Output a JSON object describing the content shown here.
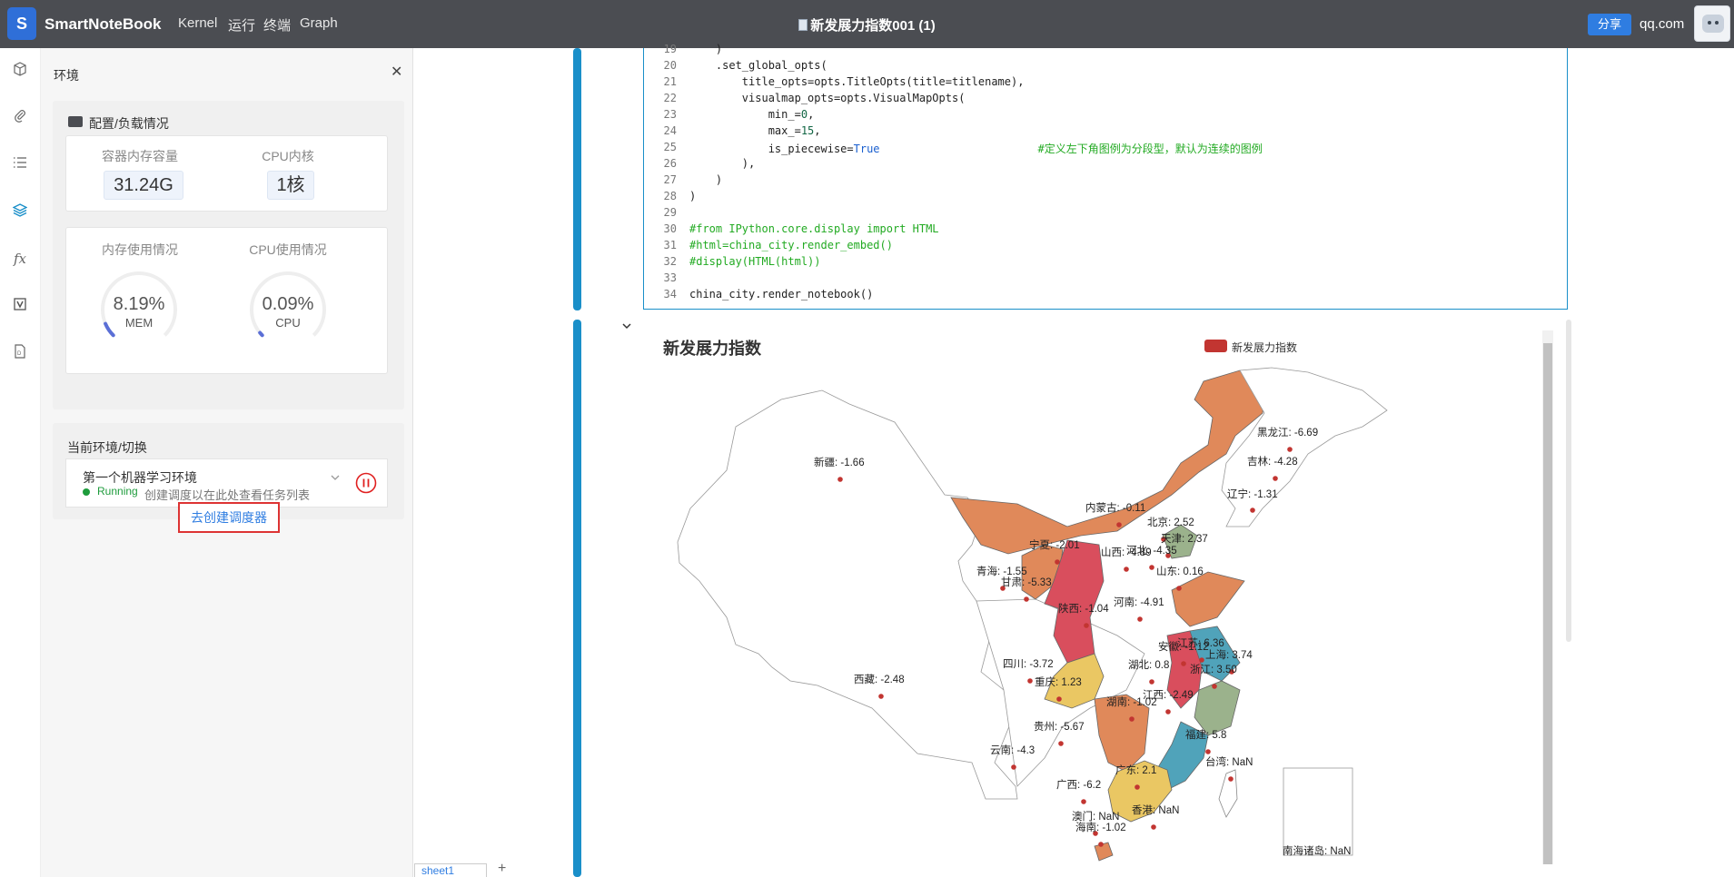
{
  "topbar": {
    "logo_text": "S",
    "brand": "SmartNoteBook",
    "menu": [
      "Kernel",
      "运行",
      "终端",
      "Graph"
    ],
    "doc_icon": "notebook-icon",
    "doc_title": "新发展力指数001 (1)",
    "share_label": "分享",
    "user": "qq.com"
  },
  "rail": {
    "icons": [
      "cube-icon",
      "paperclip-icon",
      "list-icon",
      "layers-icon",
      "fx-icon",
      "variable-icon",
      "file-icon"
    ],
    "fx_label": "fx"
  },
  "env_panel": {
    "title": "环境",
    "config": {
      "heading": "配置/负载情况",
      "mem_capacity_label": "容器内存容量",
      "mem_capacity_value": "31.24G",
      "cpu_cores_label": "CPU内核",
      "cpu_cores_value": "1核",
      "mem_usage_label": "内存使用情况",
      "mem_usage_value": "8.19%",
      "mem_usage_fraction": 0.0819,
      "mem_unit": "MEM",
      "cpu_usage_label": "CPU使用情况",
      "cpu_usage_value": "0.09%",
      "cpu_usage_fraction": 0.0009,
      "cpu_unit": "CPU"
    },
    "current_env": {
      "heading": "当前环境/切换",
      "env_name": "第一个机器学习环境",
      "status": "Running",
      "status_color": "#1e9c3c"
    },
    "schedule_text": "创建调度以在此处查看任务列表",
    "schedule_button": "去创建调度器"
  },
  "code": {
    "lines": [
      {
        "n": "19",
        "text": "    )"
      },
      {
        "n": "20",
        "text": "    .set_global_opts("
      },
      {
        "n": "21",
        "text": "        title_opts=opts.TitleOpts(title=titlename),"
      },
      {
        "n": "22",
        "text": "        visualmap_opts=opts.VisualMapOpts("
      },
      {
        "n": "23",
        "text": "            min_=",
        "num": "0",
        "tail": ","
      },
      {
        "n": "24",
        "text": "            max_=",
        "num": "15",
        "tail": ","
      },
      {
        "n": "25",
        "text": "            is_piecewise=",
        "bool": "True",
        "comment": "#定义左下角图例为分段型，默认为连续的图例"
      },
      {
        "n": "26",
        "text": "        ),"
      },
      {
        "n": "27",
        "text": "    )"
      },
      {
        "n": "28",
        "text": ")"
      },
      {
        "n": "29",
        "text": ""
      },
      {
        "n": "30",
        "text": "#from IPython.core.display import HTML",
        "is_comment": true
      },
      {
        "n": "31",
        "text": "#html=china_city.render_embed()",
        "is_comment": true
      },
      {
        "n": "32",
        "text": "#display(HTML(html))",
        "is_comment": true
      },
      {
        "n": "33",
        "text": ""
      },
      {
        "n": "34",
        "text": "china_city.render_notebook()"
      }
    ]
  },
  "output": {
    "chart_title": "新发展力指数",
    "legend_label": "新发展力指数",
    "legend_color": "#c23531"
  },
  "chart_data": {
    "type": "map",
    "title": "新发展力指数",
    "series_name": "新发展力指数",
    "visualmap": {
      "min": 0,
      "max": 15,
      "piecewise": true
    },
    "regions": [
      {
        "name": "黑龙江",
        "value": "-6.69"
      },
      {
        "name": "吉林",
        "value": "-4.28"
      },
      {
        "name": "辽宁",
        "value": "-1.31"
      },
      {
        "name": "新疆",
        "value": "-1.66"
      },
      {
        "name": "内蒙古",
        "value": "-0.11"
      },
      {
        "name": "北京",
        "value": "2.52"
      },
      {
        "name": "天津",
        "value": "2.37"
      },
      {
        "name": "宁夏",
        "value": "-2.01"
      },
      {
        "name": "山西",
        "value": "-4.89"
      },
      {
        "name": "河北",
        "value": "-4.35"
      },
      {
        "name": "山东",
        "value": "0.16"
      },
      {
        "name": "青海",
        "value": "-1.55"
      },
      {
        "name": "甘肃",
        "value": "-5.33"
      },
      {
        "name": "陕西",
        "value": "-1.04"
      },
      {
        "name": "河南",
        "value": "-4.91"
      },
      {
        "name": "安徽",
        "value": "-1.12"
      },
      {
        "name": "江苏",
        "value": "6.36"
      },
      {
        "name": "上海",
        "value": "3.74"
      },
      {
        "name": "浙江",
        "value": "3.50"
      },
      {
        "name": "西藏",
        "value": "-2.48"
      },
      {
        "name": "四川",
        "value": "-3.72"
      },
      {
        "name": "湖北",
        "value": "0.8"
      },
      {
        "name": "重庆",
        "value": "1.23"
      },
      {
        "name": "湖南",
        "value": "-1.02"
      },
      {
        "name": "江西",
        "value": "-2.49"
      },
      {
        "name": "贵州",
        "value": "-5.67"
      },
      {
        "name": "福建",
        "value": "5.8"
      },
      {
        "name": "云南",
        "value": "-4.3"
      },
      {
        "name": "台湾",
        "value": "NaN"
      },
      {
        "name": "广西",
        "value": "-6.2"
      },
      {
        "name": "广东",
        "value": "2.1"
      },
      {
        "name": "香港",
        "value": "NaN"
      },
      {
        "name": "澳门",
        "value": "NaN"
      },
      {
        "name": "海南",
        "value": "-1.02"
      },
      {
        "name": "南海诸岛",
        "value": "NaN"
      }
    ],
    "colors": {
      "orange": "#e0895a",
      "red": "#d94e5d",
      "yellow": "#eac763",
      "blue": "#50a3ba",
      "green": "#9bb28c"
    }
  },
  "sheets": {
    "tab_label": "sheet1",
    "add_label": "+"
  }
}
